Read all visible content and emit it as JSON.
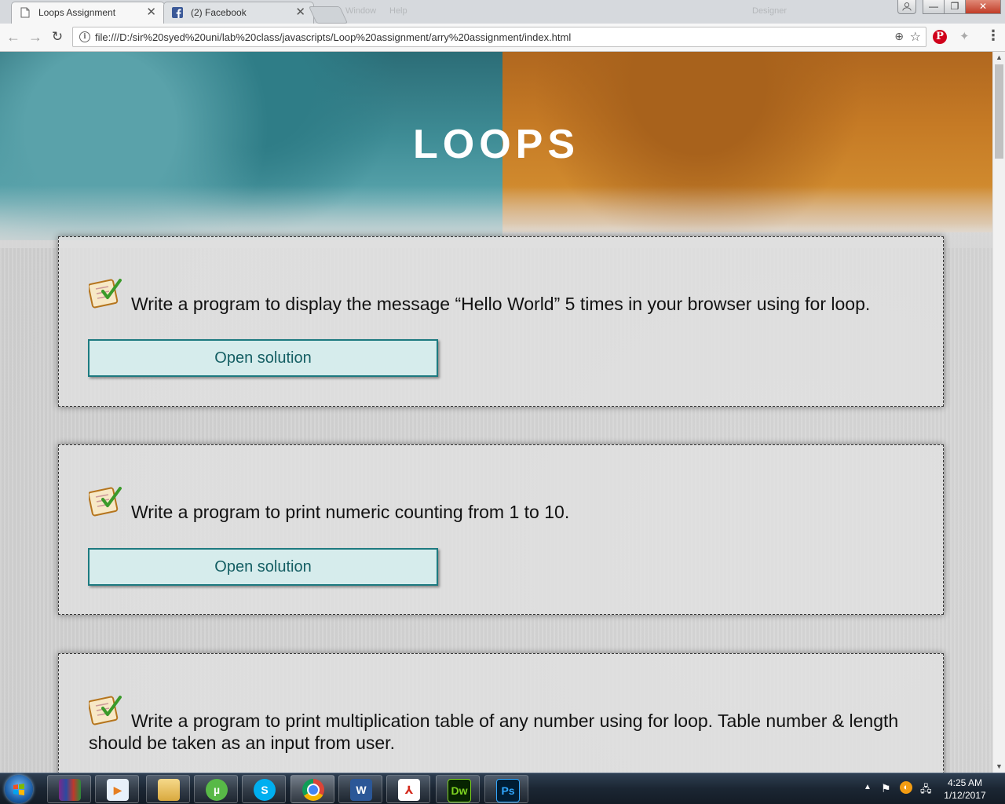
{
  "browser": {
    "tabs": [
      {
        "title": "Loops Assignment",
        "active": true,
        "icon": "page-icon"
      },
      {
        "title": "(2) Facebook",
        "active": false,
        "icon": "facebook-icon"
      }
    ],
    "ghost_menu": [
      "Window",
      "Help"
    ],
    "profile_ghost": "Designer",
    "url": "file:///D:/sir%20syed%20uni/lab%20class/javascripts/Loop%20assignment/arry%20assignment/index.html"
  },
  "page": {
    "title": "LOOPS",
    "questions": [
      {
        "text": "Write a program to display the message “Hello World” 5 times in your browser using for loop.",
        "button": "Open solution"
      },
      {
        "text": "Write a program to print numeric counting from 1 to 10.",
        "button": "Open solution"
      },
      {
        "text": "Write a program to print multiplication table of any number using for loop. Table number & length should be taken as an input from user.",
        "button": ""
      }
    ]
  },
  "taskbar": {
    "apps": [
      "winrar-icon",
      "media-player-icon",
      "file-explorer-icon",
      "utorrent-icon",
      "skype-icon",
      "chrome-icon",
      "word-icon",
      "acrobat-icon",
      "dreamweaver-icon",
      "photoshop-icon"
    ],
    "dreamweaver_label": "Dw",
    "photoshop_label": "Ps",
    "word_label": "W",
    "time": "4:25 AM",
    "date": "1/12/2017"
  },
  "colors": {
    "teal": "#3e8c95",
    "orange": "#c57a25",
    "button_bg": "#d6ecec",
    "button_border": "#1d7a80"
  }
}
